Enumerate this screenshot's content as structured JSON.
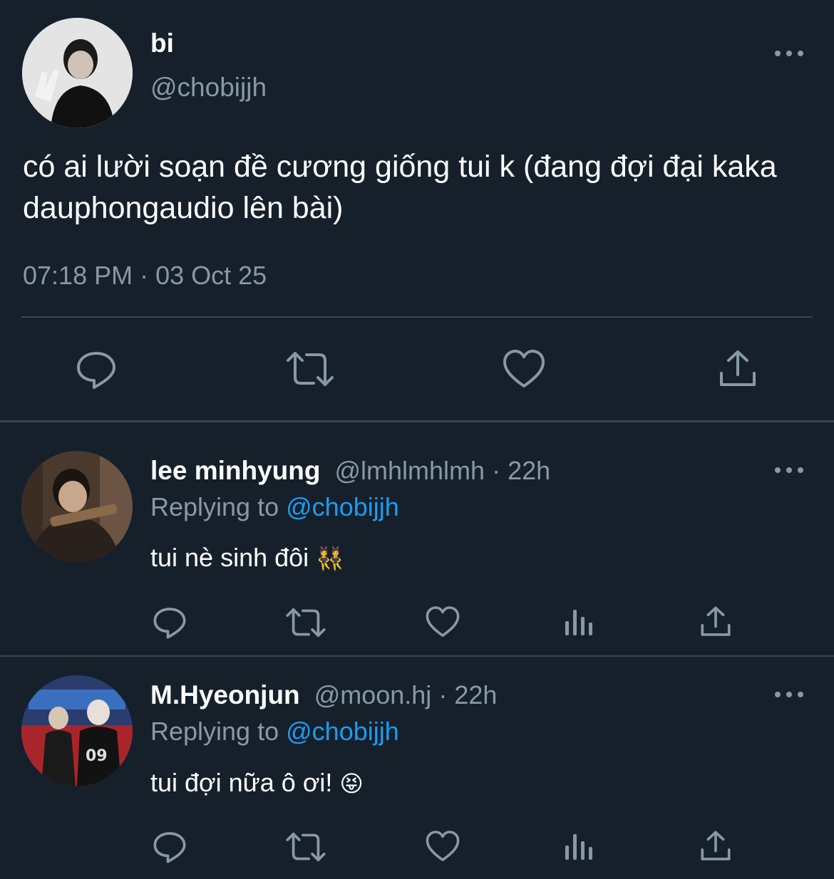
{
  "tweet": {
    "author_name": "bi",
    "author_handle": "@chobijjh",
    "text": "có ai lười soạn đề cương giống tui k (đang đợi đại kaka dauphongaudio lên bài)",
    "timestamp": "07:18 PM · 03 Oct 25",
    "actions": {
      "reply_icon": "reply-icon",
      "retweet_icon": "retweet-icon",
      "like_icon": "heart-icon",
      "share_icon": "share-icon"
    }
  },
  "replies": [
    {
      "author_name": "lee minhyung",
      "author_handle": "@lmhlmhlmh",
      "separator": "·",
      "time": "22h",
      "replying_prefix": "Replying to",
      "replying_to": "@chobijjh",
      "text": "tui nè sinh đôi",
      "emoji": "👯"
    },
    {
      "author_name": "M.Hyeonjun",
      "author_handle": "@moon.hj",
      "separator": "·",
      "time": "22h",
      "replying_prefix": "Replying to",
      "replying_to": "@chobijjh",
      "text": "tui đợi nữa ô ơi!",
      "emoji": "😝"
    }
  ],
  "colors": {
    "background": "#15202b",
    "text": "#ffffff",
    "muted": "#8899a6",
    "link": "#1d9bf0",
    "divider": "#38444d"
  }
}
